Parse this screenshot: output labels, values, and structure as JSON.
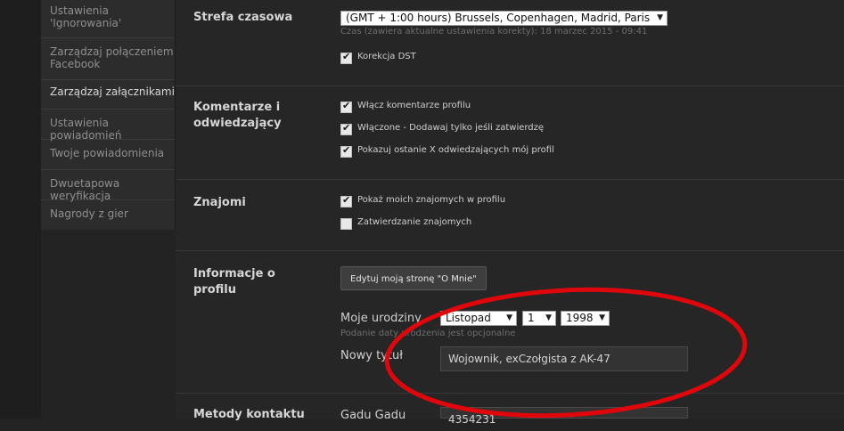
{
  "sidebar": {
    "items": [
      {
        "label": "Ustawienia 'Ignorowania'"
      },
      {
        "label": "Zarządzaj połączeniem Facebook"
      },
      {
        "label": "Zarządzaj załącznikami"
      },
      {
        "label": "Ustawienia powiadomień"
      },
      {
        "label": "Twoje powiadomienia"
      },
      {
        "label": "Dwuetapowa weryfikacja"
      },
      {
        "label": "Nagrody z gier"
      }
    ]
  },
  "timezone": {
    "label": "Strefa czasowa",
    "selected": "(GMT + 1:00 hours) Brussels, Copenhagen, Madrid, Paris",
    "hint": "Czas (zawiera aktualne ustawienia korekty): 18 marzec 2015 - 09:41",
    "dst_label": "Korekcja DST",
    "dst_checked": true
  },
  "comments": {
    "label_line1": "Komentarze i",
    "label_line2": "odwiedzający",
    "options": [
      {
        "label": "Włącz komentarze profilu",
        "checked": true
      },
      {
        "label": "Włączone - Dodawaj tylko jeśli zatwierdzę",
        "checked": true
      },
      {
        "label": "Pokazuj ostanie X odwiedzających mój profil",
        "checked": true
      }
    ]
  },
  "friends": {
    "label": "Znajomi",
    "options": [
      {
        "label": "Pokaż moich znajomych w profilu",
        "checked": true
      },
      {
        "label": "Zatwierdzanie znajomych",
        "checked": false
      }
    ]
  },
  "profile_info": {
    "label": "Informacje o profilu",
    "edit_button": "Edytuj moją stronę \"O Mnie\"",
    "birthday_label": "Moje urodziny",
    "birth_month": "Listopad",
    "birth_day": "1",
    "birth_year": "1998",
    "birthday_hint": "Podanie daty urodzenia jest opcjonalne",
    "new_title_label": "Nowy tytuł",
    "new_title_value": "Wojownik, exCzołgista z AK-47"
  },
  "contact": {
    "label": "Metody kontaktu",
    "gadu_label": "Gadu Gadu",
    "gadu_value": "4354231"
  },
  "colors": {
    "annotation": "#e0070c"
  }
}
